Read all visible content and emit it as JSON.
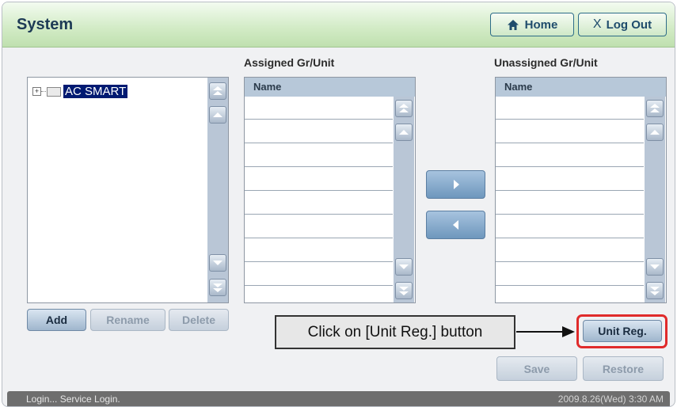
{
  "header": {
    "title": "System",
    "home_label": "Home",
    "logout_label": "Log Out",
    "logout_glyph": "X"
  },
  "tree": {
    "root_label": "AC SMART",
    "expand_glyph": "+"
  },
  "tree_buttons": {
    "add": "Add",
    "rename": "Rename",
    "delete": "Delete"
  },
  "assigned": {
    "title": "Assigned Gr/Unit",
    "column": "Name"
  },
  "unassigned": {
    "title": "Unassigned Gr/Unit",
    "column": "Name"
  },
  "actions": {
    "unit_reg": "Unit Reg.",
    "save": "Save",
    "restore": "Restore"
  },
  "callout": {
    "text": "Click on [Unit Reg.] button"
  },
  "status": {
    "left": "Login... Service Login.",
    "right": "2009.8.26(Wed)  3:30 AM"
  },
  "icons": {
    "home": "home-icon",
    "logout": "x-icon",
    "move_right": "triangle-right-icon",
    "move_left": "triangle-left-icon",
    "scroll_first": "double-up-icon",
    "scroll_up": "up-icon",
    "scroll_down": "down-icon",
    "scroll_last": "double-down-icon"
  },
  "colors": {
    "callout_highlight": "#e02b2b",
    "selected_node_bg": "#001a72"
  }
}
